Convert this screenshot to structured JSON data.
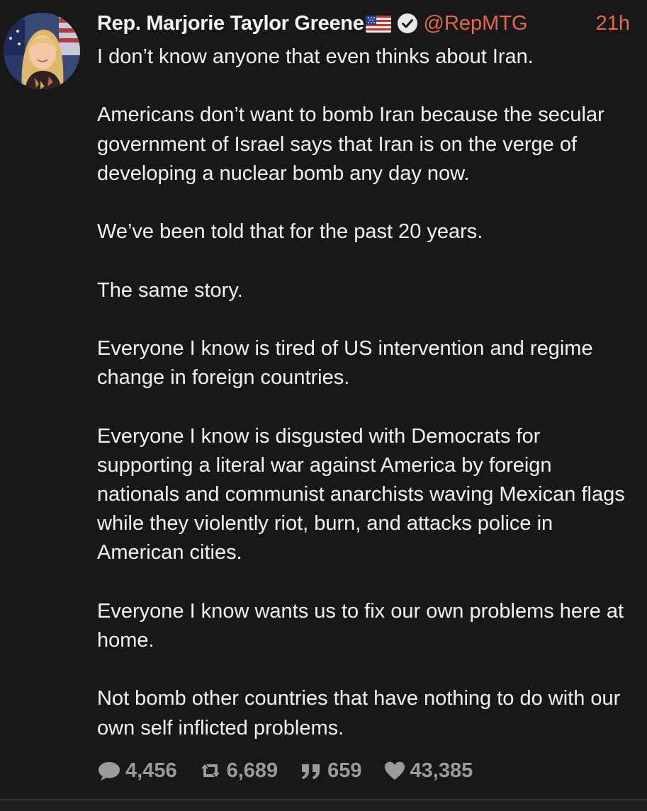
{
  "post": {
    "author_name": "Rep. Marjorie Taylor Greene",
    "flag_icon": "us-flag-icon",
    "verified_icon": "verified-check-icon",
    "handle": "@RepMTG",
    "time": "21h",
    "paragraphs": [
      "I don’t know anyone that even thinks about Iran.",
      "Americans don’t want to bomb Iran because the secular government of Israel says that Iran is on the verge of developing a nuclear bomb any day now.",
      "We’ve been told that for the past 20 years.",
      "The same story.",
      "Everyone I know is tired of US intervention and regime change in foreign countries.",
      "Everyone I know is disgusted with Democrats for supporting a literal war against America by foreign nationals and communist anarchists waving Mexican flags while they violently riot, burn, and attacks police in American cities.",
      "Everyone I know wants us to fix our own problems here at home.",
      "Not bomb other countries that have nothing to do with our own self inflicted problems."
    ],
    "stats": {
      "replies": "4,456",
      "reposts": "6,689",
      "quotes": "659",
      "likes": "43,385"
    }
  },
  "colors": {
    "background": "#181818",
    "text": "#f2f2f2",
    "accent": "#e5684f",
    "muted": "#9b9b9b"
  }
}
